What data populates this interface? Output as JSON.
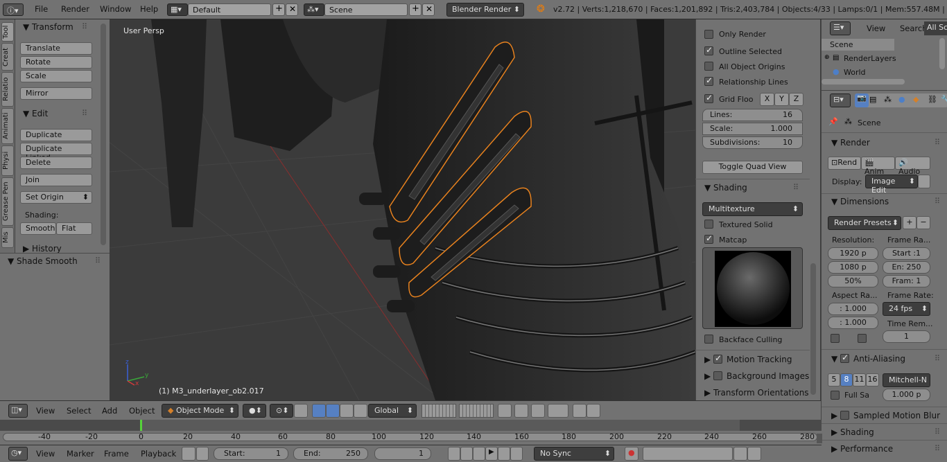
{
  "topbar": {
    "menus": [
      "File",
      "Render",
      "Window",
      "Help"
    ],
    "screen_layout": "Default",
    "scene": "Scene",
    "engine": "Blender Render",
    "stats": "v2.72 | Verts:1,218,670 | Faces:1,201,892 | Tris:2,403,784 | Objects:4/33 | Lamps:0/1 | Mem:557.48M | M3_un"
  },
  "tool_tabs": [
    "Tool",
    "Creat",
    "Relatio",
    "Animati",
    "Physi",
    "Grease Pen",
    "Mis"
  ],
  "toolshelf": {
    "transform_title": "Transform",
    "translate": "Translate",
    "rotate": "Rotate",
    "scale": "Scale",
    "mirror": "Mirror",
    "edit_title": "Edit",
    "duplicate": "Duplicate",
    "duplicate_linked": "Duplicate Linked",
    "delete": "Delete",
    "join": "Join",
    "set_origin": "Set Origin",
    "shading_label": "Shading:",
    "smooth": "Smooth",
    "flat": "Flat",
    "history": "History",
    "operator": "Shade Smooth"
  },
  "viewport": {
    "view_label": "User Persp",
    "object_label": "(1) M3_underlayer_ob2.017"
  },
  "npanel": {
    "only_render": "Only Render",
    "outline_selected": "Outline Selected",
    "all_object_origins": "All Object Origins",
    "relationship_lines": "Relationship Lines",
    "grid_floor": "Grid Floo",
    "axis_x": "X",
    "axis_y": "Y",
    "axis_z": "Z",
    "lines_label": "Lines:",
    "lines_value": "16",
    "scale_label": "Scale:",
    "scale_value": "1.000",
    "subdiv_label": "Subdivisions:",
    "subdiv_value": "10",
    "toggle_quad": "Toggle Quad View",
    "shading_title": "Shading",
    "shading_mode": "Multitexture",
    "textured_solid": "Textured Solid",
    "matcap": "Matcap",
    "backface_culling": "Backface Culling",
    "motion_tracking": "Motion Tracking",
    "background_images": "Background Images",
    "transform_orientations": "Transform Orientations"
  },
  "outliner": {
    "view": "View",
    "search": "Search",
    "all_scenes": "All Sc",
    "items": [
      "Scene",
      "RenderLayers",
      "World"
    ]
  },
  "properties": {
    "context": "Scene",
    "render_title": "Render",
    "rend_btn": "Rend",
    "anim_btn": "Anim",
    "audio_btn": "Audio",
    "display_label": "Display:",
    "display_value": "Image Edit",
    "dimensions_title": "Dimensions",
    "render_presets": "Render Presets",
    "resolution_label": "Resolution:",
    "frame_range_label": "Frame Ra...",
    "res_x": "1920 p",
    "res_y": "1080 p",
    "res_pct": "50%",
    "start": "Start :1",
    "end": "En: 250",
    "frame": "Fram: 1",
    "aspect_label": "Aspect Ra...",
    "frame_rate_label": "Frame Rate:",
    "aspect_x": ": 1.000",
    "aspect_y": ": 1.000",
    "fps": "24 fps",
    "time_remap_label": "Time Rem...",
    "time_remap": "1",
    "aa_title": "Anti-Aliasing",
    "aa_samples": [
      "5",
      "8",
      "11",
      "16"
    ],
    "aa_filter": "Mitchell-N",
    "full_sample": "Full Sa",
    "filter_size": "1.000 p",
    "sampled_motion_blur": "Sampled Motion Blur",
    "shading_title": "Shading",
    "performance_title": "Performance"
  },
  "view3d_header": {
    "view": "View",
    "select": "Select",
    "add": "Add",
    "object": "Object",
    "mode": "Object Mode",
    "orientation": "Global"
  },
  "timeline": {
    "ruler": [
      "-40",
      "-20",
      "0",
      "20",
      "40",
      "60",
      "80",
      "100",
      "120",
      "140",
      "160",
      "180",
      "200",
      "220",
      "240",
      "260",
      "280"
    ],
    "view": "View",
    "marker": "Marker",
    "frame": "Frame",
    "playback": "Playback",
    "start_label": "Start:",
    "start_value": "1",
    "end_label": "End:",
    "end_value": "250",
    "current_frame": "1",
    "sync": "No Sync"
  },
  "colors": {
    "selection_outline": "#e8821e",
    "panel_bg": "#727272",
    "viewport_bg": "#3b3b3b",
    "accent_blue": "#5680c2"
  }
}
